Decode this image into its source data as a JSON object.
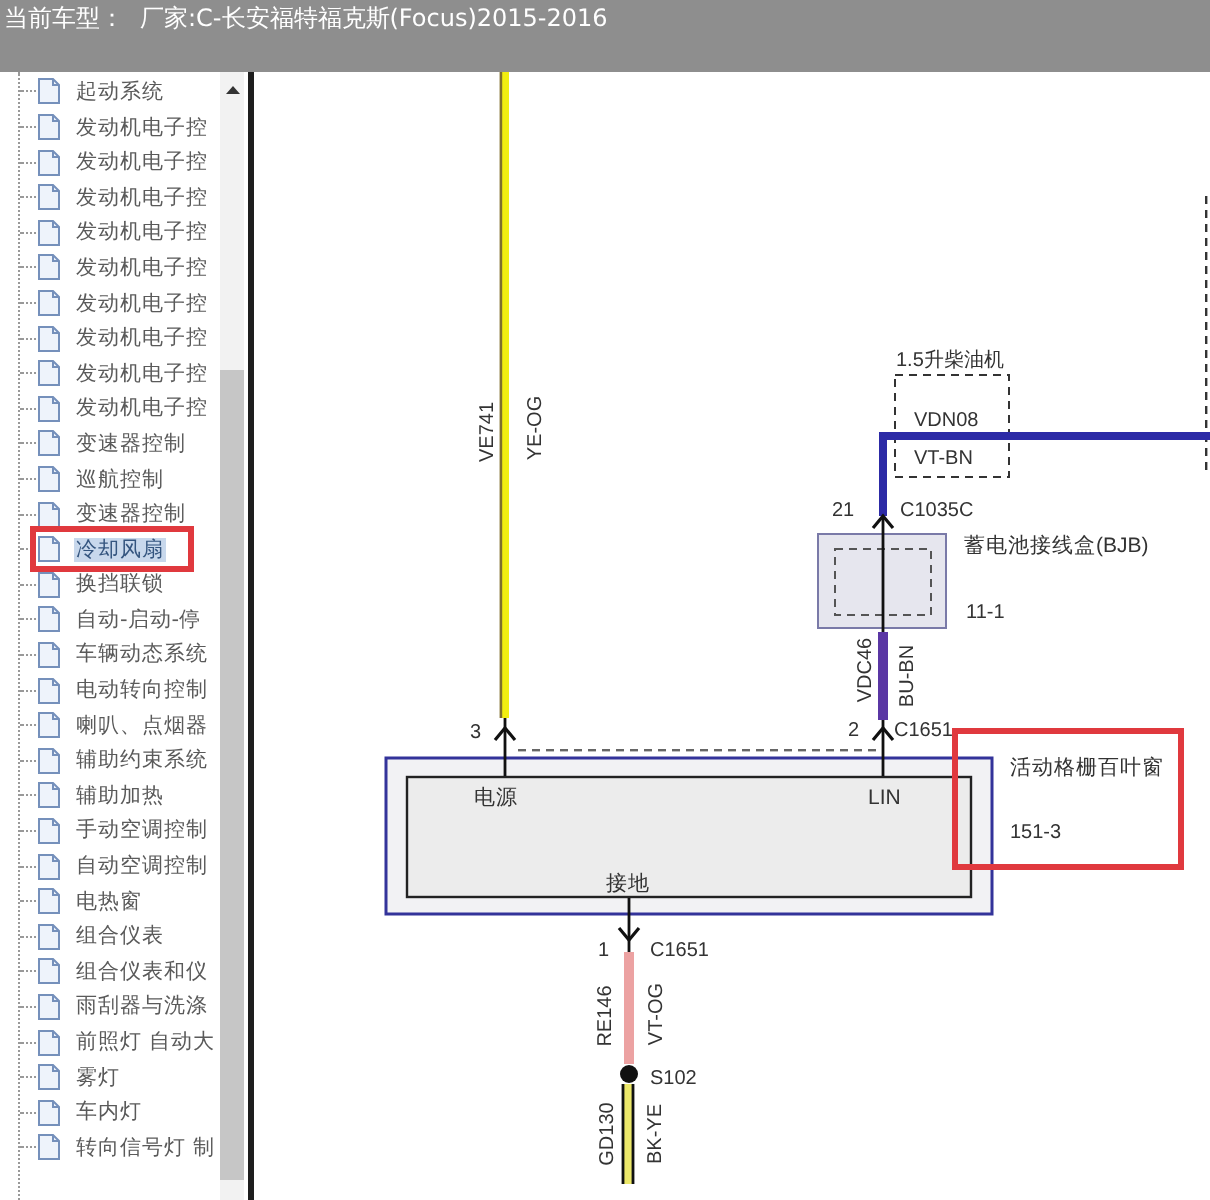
{
  "header": {
    "label": "当前车型：",
    "value": "厂家:C-长安福特福克斯(Focus)2015-2016"
  },
  "tree": {
    "items": [
      {
        "label": "起动系统",
        "selected": false
      },
      {
        "label": "发动机电子控",
        "selected": false
      },
      {
        "label": "发动机电子控",
        "selected": false
      },
      {
        "label": "发动机电子控",
        "selected": false
      },
      {
        "label": "发动机电子控",
        "selected": false
      },
      {
        "label": "发动机电子控",
        "selected": false
      },
      {
        "label": "发动机电子控",
        "selected": false
      },
      {
        "label": "发动机电子控",
        "selected": false
      },
      {
        "label": "发动机电子控",
        "selected": false
      },
      {
        "label": "发动机电子控",
        "selected": false
      },
      {
        "label": "变速器控制",
        "selected": false
      },
      {
        "label": "巡航控制",
        "selected": false
      },
      {
        "label": "变速器控制",
        "selected": false
      },
      {
        "label": "冷却风扇",
        "selected": true
      },
      {
        "label": "换挡联锁",
        "selected": false
      },
      {
        "label": "自动-启动-停",
        "selected": false
      },
      {
        "label": "车辆动态系统",
        "selected": false
      },
      {
        "label": "电动转向控制",
        "selected": false
      },
      {
        "label": "喇叭、点烟器",
        "selected": false
      },
      {
        "label": "辅助约束系统",
        "selected": false
      },
      {
        "label": "辅助加热",
        "selected": false
      },
      {
        "label": "手动空调控制",
        "selected": false
      },
      {
        "label": "自动空调控制",
        "selected": false
      },
      {
        "label": "电热窗",
        "selected": false
      },
      {
        "label": "组合仪表",
        "selected": false
      },
      {
        "label": "组合仪表和仪",
        "selected": false
      },
      {
        "label": "雨刮器与洗涤",
        "selected": false
      },
      {
        "label": "前照灯 自动大",
        "selected": false
      },
      {
        "label": "雾灯",
        "selected": false
      },
      {
        "label": "车内灯",
        "selected": false
      },
      {
        "label": "转向信号灯 制",
        "selected": false
      }
    ]
  },
  "diagram": {
    "wires": [
      {
        "circuit": "VE741",
        "color_code": "YE-OG",
        "color": "#f2ee10"
      },
      {
        "circuit": "VDN08",
        "color_code": "VT-BN",
        "color": "#2c2aa6"
      },
      {
        "circuit": "VDC46",
        "color_code": "BU-BN",
        "color": "#5a36a4"
      },
      {
        "circuit": "RE146",
        "color_code": "VT-OG",
        "color": "#eca2a2"
      },
      {
        "circuit": "GD130",
        "color_code": "BK-YE",
        "color": "#ece86a"
      }
    ],
    "pins": [
      {
        "number": "3"
      },
      {
        "number": "21",
        "connector": "C1035C"
      },
      {
        "number": "2",
        "connector": "C1651"
      },
      {
        "number": "1",
        "connector": "C1651"
      }
    ],
    "engine_option": "1.5升柴油机",
    "junction_box": {
      "name": "蓄电池接线盒(BJB)",
      "ref": "11-1"
    },
    "module": {
      "name": "活动格栅百叶窗",
      "ref": "151-3",
      "terminals": [
        "电源",
        "LIN",
        "接地"
      ]
    },
    "splice": "S102"
  }
}
